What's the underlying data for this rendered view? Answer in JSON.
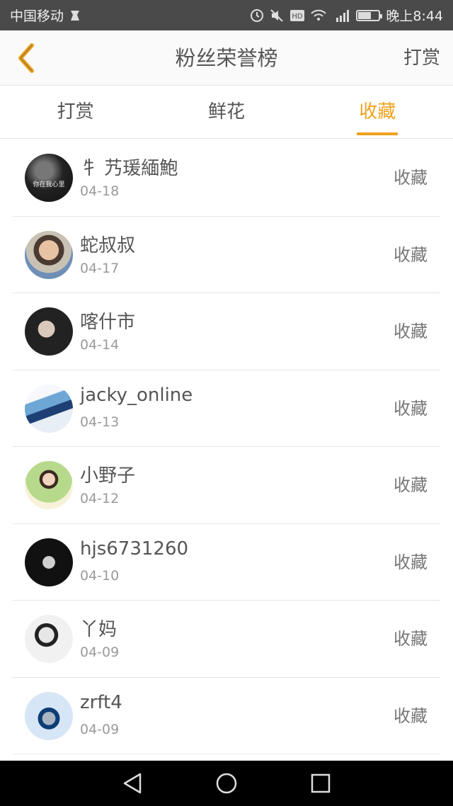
{
  "status_bar": {
    "carrier": "中国移动",
    "time": "晚上8:44",
    "icons": [
      "carrier-badge-icon",
      "alarm-icon",
      "mute-icon",
      "hd-icon",
      "wifi-icon",
      "4g-signal-icon",
      "battery-icon"
    ],
    "battery_level": 0.65
  },
  "header": {
    "title": "粉丝荣誉榜",
    "action_label": "打赏",
    "back_icon": "chevron-left-icon",
    "accent_color": "#f0a21e"
  },
  "tabs": [
    {
      "label": "打赏",
      "active": false
    },
    {
      "label": "鲜花",
      "active": false
    },
    {
      "label": "收藏",
      "active": true
    }
  ],
  "list": [
    {
      "name": "牜 艿瑗緬鮑",
      "date": "04-18",
      "action": "收藏",
      "avatar_text": "你在我心里"
    },
    {
      "name": "蛇叔叔",
      "date": "04-17",
      "action": "收藏"
    },
    {
      "name": "喀什市",
      "date": "04-14",
      "action": "收藏"
    },
    {
      "name": "jacky_online",
      "date": "04-13",
      "action": "收藏"
    },
    {
      "name": "小野子",
      "date": "04-12",
      "action": "收藏"
    },
    {
      "name": "hjs6731260",
      "date": "04-10",
      "action": "收藏"
    },
    {
      "name": "丫妈",
      "date": "04-09",
      "action": "收藏"
    },
    {
      "name": "zrft4",
      "date": "04-09",
      "action": "收藏"
    }
  ],
  "nav_bar": {
    "icons": [
      "back-triangle-icon",
      "home-circle-icon",
      "recents-square-icon"
    ]
  }
}
